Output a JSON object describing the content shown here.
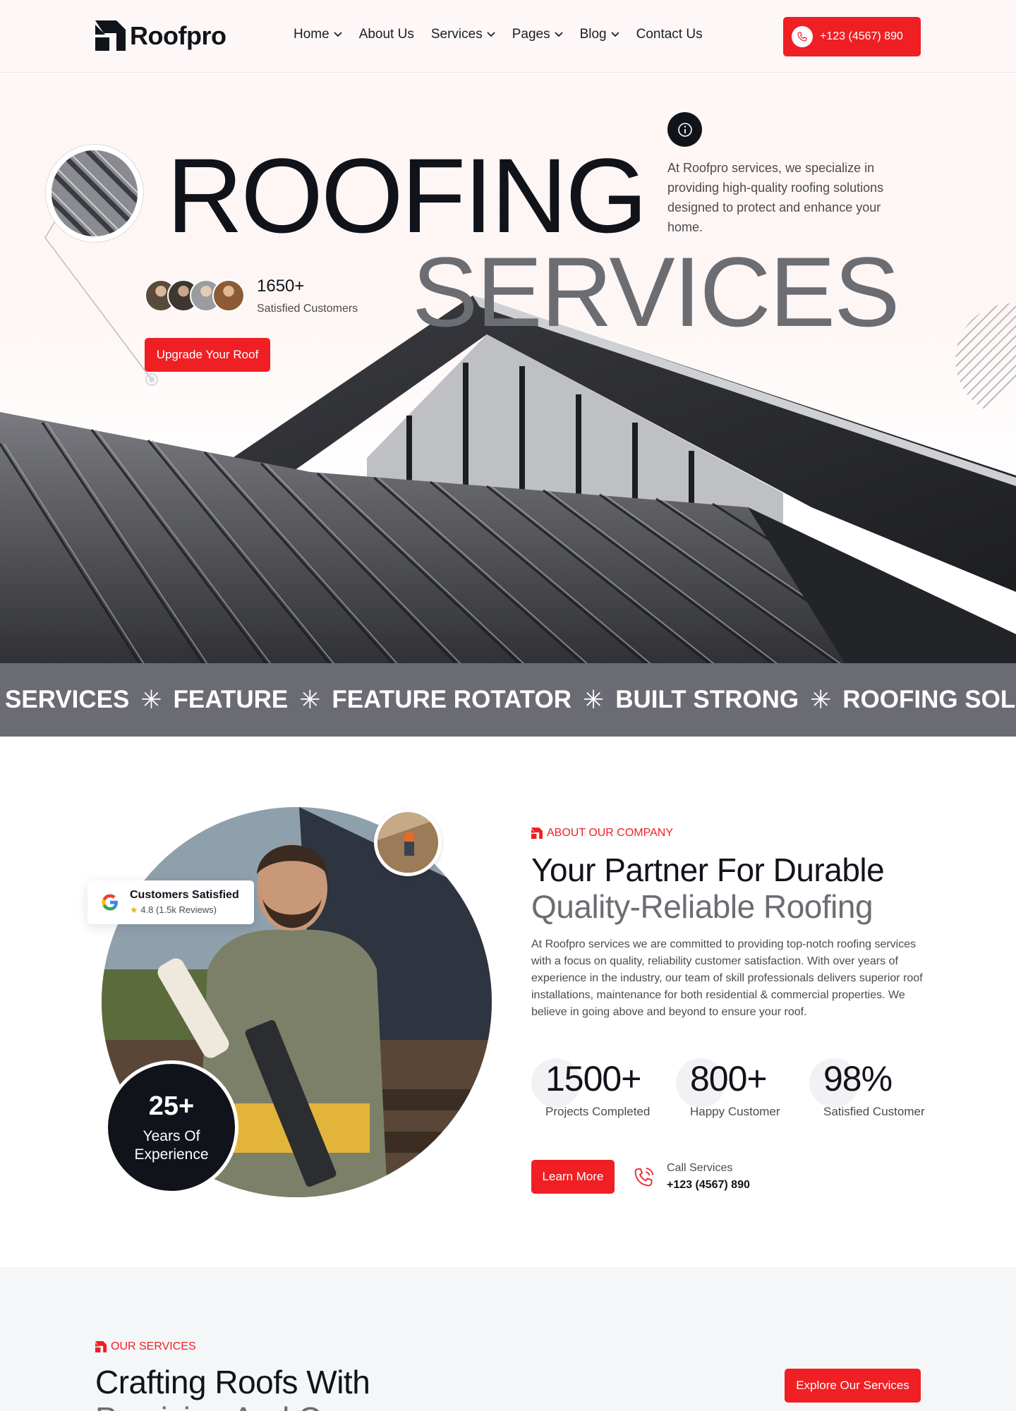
{
  "brand": {
    "name": "Roofpro",
    "accent": "#ef1f24",
    "dark": "#11131a",
    "gray": "#6b6c73"
  },
  "header": {
    "nav": [
      {
        "label": "Home",
        "dropdown": true
      },
      {
        "label": "About Us",
        "dropdown": false
      },
      {
        "label": "Services",
        "dropdown": true
      },
      {
        "label": "Pages",
        "dropdown": true
      },
      {
        "label": "Blog",
        "dropdown": true
      },
      {
        "label": "Contact Us",
        "dropdown": false
      }
    ],
    "phone": "+123 (4567) 890"
  },
  "hero": {
    "title_1": "ROOFING",
    "title_2": "SERVICES",
    "description": "At Roofpro services, we specialize in providing high-quality roofing solutions designed to protect and enhance your home.",
    "customers_count": "1650+",
    "customers_label": "Satisfied Customers",
    "cta": "Upgrade Your Roof"
  },
  "ticker": [
    "SERVICES",
    "FEATURE",
    "FEATURE ROTATOR",
    "BUILT STRONG",
    "ROOFING SOLUTIONS"
  ],
  "about": {
    "eyebrow": "ABOUT OUR COMPANY",
    "heading_1": "Your Partner For Durable",
    "heading_2": "Quality-Reliable Roofing",
    "description": "At Roofpro services we are committed to providing top-notch roofing services with a focus on quality, reliability customer satisfaction. With over years of experience in the industry, our team of skill professionals delivers superior roof installations, maintenance for both residential & commercial properties. We believe in going above and beyond to ensure your roof.",
    "review_title": "Customers Satisfied",
    "review_sub": "4.8 (1.5k Reviews)",
    "years_num": "25+",
    "years_label": "Years Of Experience",
    "stats": [
      {
        "value": "1500+",
        "label": "Projects Completed"
      },
      {
        "value": "800+",
        "label": "Happy Customer"
      },
      {
        "value": "98%",
        "label": "Satisfied Customer"
      }
    ],
    "cta": "Learn More",
    "call_label": "Call Services",
    "call_number": "+123 (4567) 890"
  },
  "services": {
    "eyebrow": "OUR SERVICES",
    "heading_1": "Crafting Roofs With",
    "heading_2": "Precision And Care",
    "cta": "Explore Our Services"
  }
}
